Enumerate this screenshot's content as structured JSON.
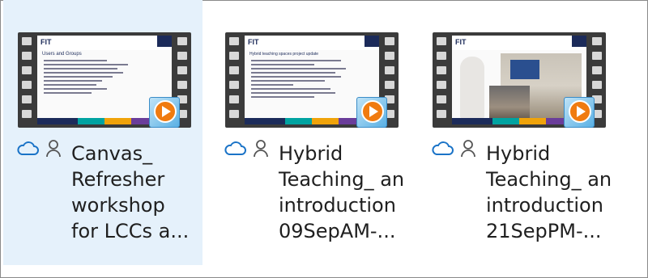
{
  "files": [
    {
      "selected": true,
      "name_lines": [
        "Canvas_",
        "Refresher",
        "workshop",
        "for LCCs a..."
      ],
      "slide_title": "Users and Groups",
      "status_icons": [
        "cloud-icon",
        "person-icon"
      ]
    },
    {
      "selected": false,
      "name_lines": [
        "Hybrid",
        "Teaching_ an",
        "introduction",
        "09SepAM-..."
      ],
      "slide_title": "Hybrid teaching spaces project update",
      "status_icons": [
        "cloud-icon",
        "person-icon"
      ]
    },
    {
      "selected": false,
      "name_lines": [
        "Hybrid",
        "Teaching_ an",
        "introduction",
        "21SepPM-..."
      ],
      "slide_title": "",
      "status_icons": [
        "cloud-icon",
        "person-icon"
      ]
    }
  ],
  "colors": {
    "selection": "#e5f1fb",
    "cloud": "#1a73c7",
    "play": "#f07b10"
  }
}
